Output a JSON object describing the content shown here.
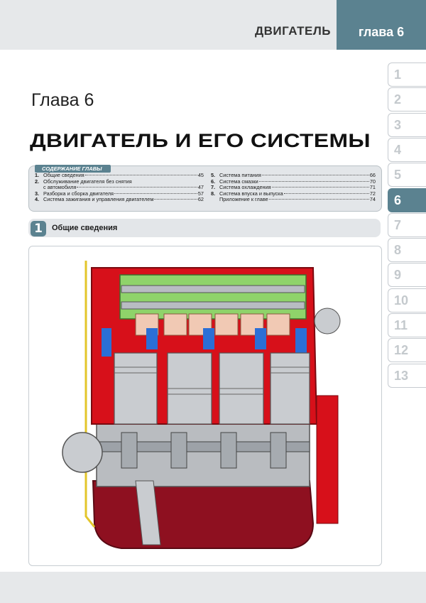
{
  "header": {
    "section": "ДВИГАТЕЛЬ",
    "chapter_label": "глава 6"
  },
  "chapter": {
    "number": "Глава 6",
    "title": "ДВИГАТЕЛЬ И ЕГО СИСТЕМЫ"
  },
  "toc": {
    "heading": "СОДЕРЖАНИЕ ГЛАВЫ",
    "left": [
      {
        "n": "1.",
        "title": "Общие сведения",
        "page": "45"
      },
      {
        "n": "2.",
        "title": "Обслуживание двигателя без снятия",
        "page": ""
      },
      {
        "n": "",
        "title": "с автомобиля",
        "page": "47"
      },
      {
        "n": "3.",
        "title": "Разборка и сборка двигателя",
        "page": "57"
      },
      {
        "n": "4.",
        "title": "Система зажигания и управления двигателем",
        "page": "62"
      }
    ],
    "right": [
      {
        "n": "5.",
        "title": "Система питания",
        "page": "66"
      },
      {
        "n": "6.",
        "title": "Система смазки",
        "page": "70"
      },
      {
        "n": "7.",
        "title": "Система охлаждения",
        "page": "71"
      },
      {
        "n": "8.",
        "title": "Система впуска и выпуска",
        "page": "72"
      },
      {
        "n": "",
        "title": "Приложение к главе",
        "page": "74"
      }
    ]
  },
  "section": {
    "number": "1",
    "title": "Общие сведения"
  },
  "side_tabs": [
    "1",
    "2",
    "3",
    "4",
    "5",
    "6",
    "7",
    "8",
    "9",
    "10",
    "11",
    "12",
    "13"
  ],
  "active_tab": "6",
  "colors": {
    "accent": "#5b8290",
    "band": "#e6e8ea",
    "engine_red": "#d7101a",
    "coolant_blue": "#2b6fd6",
    "head_green": "#8fd36a",
    "sump_maroon": "#8e1020"
  }
}
